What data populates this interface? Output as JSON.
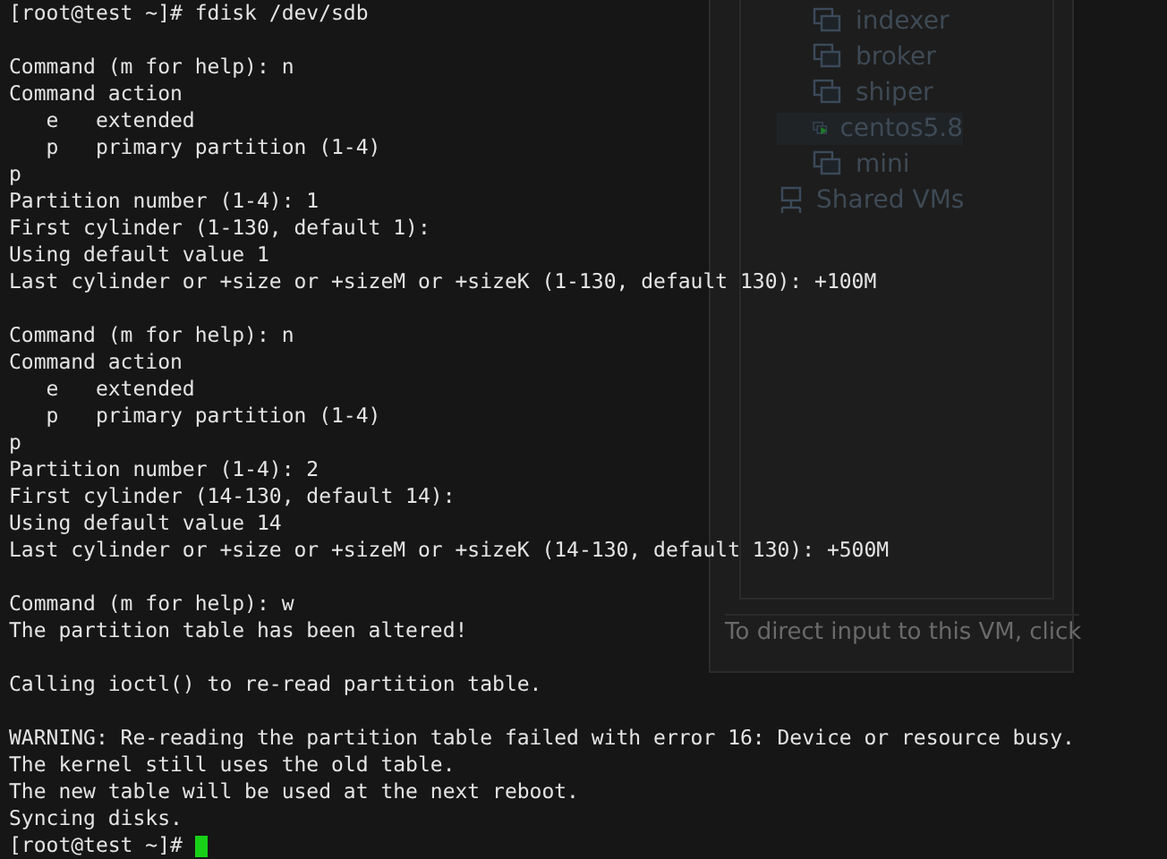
{
  "vm_window": {
    "items": [
      {
        "label": "indexer",
        "running": false
      },
      {
        "label": "broker",
        "running": false
      },
      {
        "label": "shiper",
        "running": false
      },
      {
        "label": "centos5.8",
        "running": true
      },
      {
        "label": "mini",
        "running": false
      }
    ],
    "shared": "Shared VMs",
    "hint": "To direct input to this VM, click"
  },
  "terminal": {
    "blocks": [
      [
        "[root@test ~]# fdisk /dev/sdb"
      ],
      [
        "Command (m for help): n",
        "Command action",
        "   e   extended",
        "   p   primary partition (1-4)",
        "p",
        "Partition number (1-4): 1",
        "First cylinder (1-130, default 1):",
        "Using default value 1",
        "Last cylinder or +size or +sizeM or +sizeK (1-130, default 130): +100M"
      ],
      [
        "Command (m for help): n",
        "Command action",
        "   e   extended",
        "   p   primary partition (1-4)",
        "p",
        "Partition number (1-4): 2",
        "First cylinder (14-130, default 14):",
        "Using default value 14",
        "Last cylinder or +size or +sizeM or +sizeK (14-130, default 130): +500M"
      ],
      [
        "Command (m for help): w",
        "The partition table has been altered!"
      ],
      [
        "Calling ioctl() to re-read partition table."
      ],
      [
        "WARNING: Re-reading the partition table failed with error 16: Device or resource busy.",
        "The kernel still uses the old table.",
        "The new table will be used at the next reboot.",
        "Syncing disks."
      ]
    ],
    "prompt": "[root@test ~]# "
  }
}
